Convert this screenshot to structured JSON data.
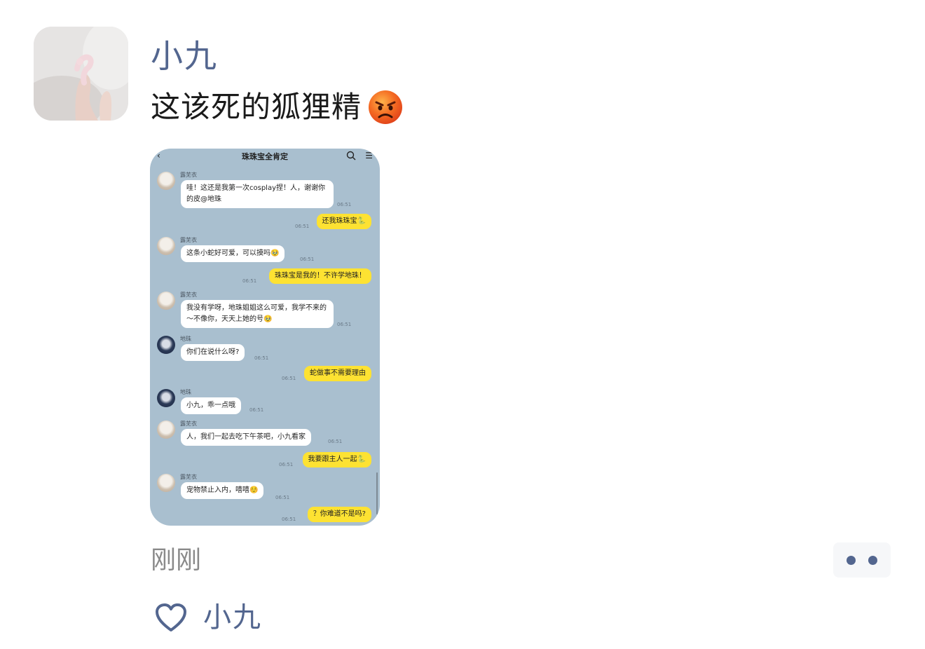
{
  "post": {
    "username": "小九",
    "text": "这该死的狐狸精",
    "emoji": "angry-face",
    "time": "刚刚",
    "likes": [
      "小九"
    ]
  },
  "shot": {
    "title": "珠珠宝全肯定",
    "messages": [
      {
        "side": "left",
        "sender": "露芜衣",
        "text": "哇！这还是我第一次cosplay捏！人，谢谢你的皮@地珠",
        "time": "06:51"
      },
      {
        "side": "right",
        "text": "还我珠珠宝🐍",
        "time": "06:51"
      },
      {
        "side": "left",
        "sender": "露芜衣",
        "text": "这条小蛇好可爱，可以摸吗🥹",
        "time": "06:51"
      },
      {
        "side": "right",
        "text": "珠珠宝是我的！不许学地珠！",
        "time": "06:51"
      },
      {
        "side": "left",
        "sender": "露芜衣",
        "text": "我没有学呀，地珠姐姐这么可爱，我学不来的～不像你，天天上她的号🥹",
        "time": "06:51"
      },
      {
        "side": "left",
        "sender": "地珠",
        "text": "你们在说什么呀?",
        "time": "06:51"
      },
      {
        "side": "right",
        "text": "蛇做事不需要理由",
        "time": "06:51"
      },
      {
        "side": "left",
        "sender": "地珠",
        "text": "小九，乖一点哦",
        "time": "06:51"
      },
      {
        "side": "left",
        "sender": "露芜衣",
        "text": "人，我们一起去吃下午茶吧，小九看家",
        "time": "06:51"
      },
      {
        "side": "right",
        "text": "我要跟主人一起🐍",
        "time": "06:51"
      },
      {
        "side": "left",
        "sender": "露芜衣",
        "text": "宠物禁止入内，嘻嘻☺️",
        "time": "06:51"
      },
      {
        "side": "right",
        "text": "？你难道不是吗?",
        "time": "06:51"
      }
    ]
  },
  "colors": {
    "name_blue": "#53668f",
    "chat_bg": "#a9bfcf",
    "bubble_yellow": "#fde232"
  }
}
